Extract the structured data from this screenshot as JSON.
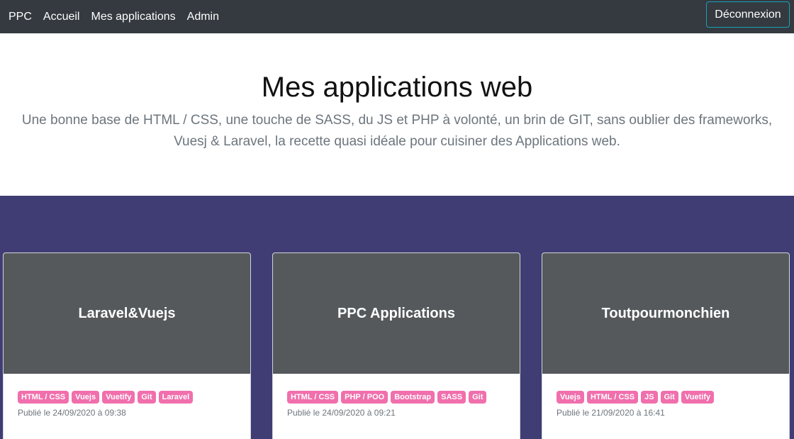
{
  "navbar": {
    "brand": "PPC",
    "links": [
      "Accueil",
      "Mes applications",
      "Admin"
    ],
    "logout_label": "Déconnexion"
  },
  "hero": {
    "title": "Mes applications web",
    "lead": "Une bonne base de HTML / CSS, une touche de SASS, du JS et PHP à volonté, un brin de GIT, sans oublier des frameworks, Vuesj & Laravel, la recette quasi idéale pour cuisiner des Applications web."
  },
  "apps": [
    {
      "title": "Laravel&Vuejs",
      "tags": [
        "HTML / CSS",
        "Vuejs",
        "Vuetify",
        "Git",
        "Laravel"
      ],
      "published": "Publié le 24/09/2020 à 09:38"
    },
    {
      "title": "PPC Applications",
      "tags": [
        "HTML / CSS",
        "PHP / POO",
        "Bootstrap",
        "SASS",
        "Git"
      ],
      "published": "Publié le 24/09/2020 à 09:21"
    },
    {
      "title": "Toutpourmonchien",
      "tags": [
        "Vuejs",
        "HTML / CSS",
        "JS",
        "Git",
        "Vuetify"
      ],
      "published": "Publié le 21/09/2020 à 16:41"
    }
  ],
  "colors": {
    "navbar_bg": "#343a40",
    "section_bg": "#403d74",
    "card_cover_bg": "#55595c",
    "tag_bg": "#f06fac",
    "logout_border": "#17a2b8"
  }
}
